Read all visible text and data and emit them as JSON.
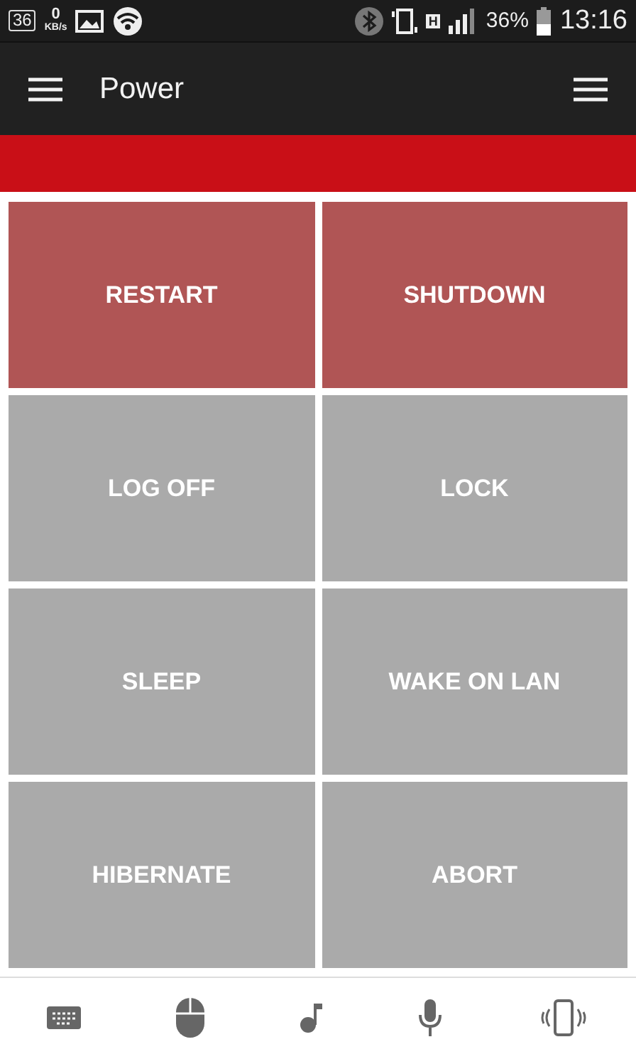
{
  "status_bar": {
    "badge": "36",
    "speed_value": "0",
    "speed_unit": "KB/s",
    "network": "H",
    "battery": "36%",
    "time": "13:16"
  },
  "toolbar": {
    "title": "Power"
  },
  "tiles": [
    {
      "label": "RESTART",
      "kind": "danger"
    },
    {
      "label": "SHUTDOWN",
      "kind": "danger"
    },
    {
      "label": "LOG OFF",
      "kind": "normal"
    },
    {
      "label": "LOCK",
      "kind": "normal"
    },
    {
      "label": "SLEEP",
      "kind": "normal"
    },
    {
      "label": "WAKE ON LAN",
      "kind": "normal"
    },
    {
      "label": "HIBERNATE",
      "kind": "normal"
    },
    {
      "label": "ABORT",
      "kind": "normal"
    }
  ]
}
